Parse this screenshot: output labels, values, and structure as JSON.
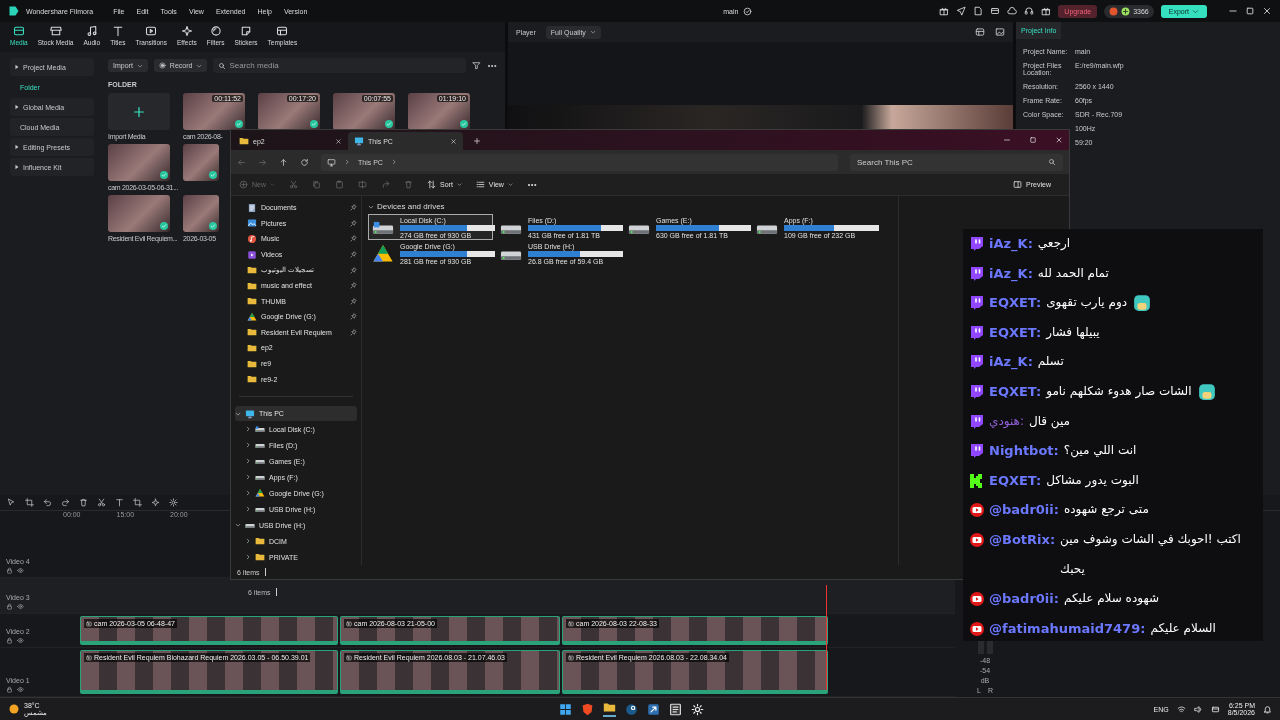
{
  "filmora": {
    "app_title": "Wondershare Filmora",
    "menus": [
      "File",
      "Edit",
      "Tools",
      "View",
      "Extended",
      "Help",
      "Version"
    ],
    "project_name": "main",
    "upgrade": "Upgrade",
    "credits": "3366",
    "export": "Export",
    "tabs": [
      {
        "label": "Media",
        "selected": true
      },
      {
        "label": "Stock Media",
        "selected": false
      },
      {
        "label": "Audio",
        "selected": false
      },
      {
        "label": "Titles",
        "selected": false
      },
      {
        "label": "Transitions",
        "selected": false
      },
      {
        "label": "Effects",
        "selected": false
      },
      {
        "label": "Filters",
        "selected": false
      },
      {
        "label": "Stickers",
        "selected": false
      },
      {
        "label": "Templates",
        "selected": false
      }
    ],
    "sidebar": [
      {
        "label": "Project Media",
        "kind": "group",
        "selected": false
      },
      {
        "label": "Folder",
        "kind": "item",
        "selected": true
      },
      {
        "label": "Global Media",
        "kind": "group",
        "selected": false
      },
      {
        "label": "Cloud Media",
        "kind": "plain",
        "selected": false
      },
      {
        "label": "Editing Presets",
        "kind": "group",
        "selected": false
      },
      {
        "label": "Influence Kit",
        "kind": "group",
        "selected": false
      }
    ],
    "media_bar": {
      "import": "Import",
      "record": "Record",
      "search_placeholder": "Search media"
    },
    "folder_label": "FOLDER",
    "media_rows": [
      [
        {
          "kind": "import",
          "name": "Import Media"
        },
        {
          "kind": "clip",
          "name": "cam 2026-08-",
          "duration": "00:11:52"
        },
        {
          "kind": "clip",
          "duration": "00:17:20"
        },
        {
          "kind": "clip",
          "duration": "00:07:55"
        },
        {
          "kind": "clip",
          "duration": "01:19:10"
        }
      ],
      [
        {
          "kind": "clip",
          "name": "cam 2026-03-05-06-31..."
        },
        {
          "kind": "clip"
        }
      ],
      [
        {
          "kind": "clip",
          "name": "Resident Evil Requiem..."
        },
        {
          "kind": "clip",
          "name": "2026-03-05"
        }
      ]
    ],
    "player": {
      "label": "Player",
      "quality": "Full Quality"
    },
    "project_info": {
      "tab": "Project Info",
      "rows": [
        {
          "label": "Project Name:",
          "value": "main"
        },
        {
          "label": "Project Files Location:",
          "value": "E:/re9/main.wfp"
        },
        {
          "label": "Resolution:",
          "value": "2560 x 1440"
        },
        {
          "label": "Frame Rate:",
          "value": "60fps"
        },
        {
          "label": "Color Space:",
          "value": "SDR - Rec.709"
        },
        {
          "value": "100Hz"
        },
        {
          "value": "59:20"
        }
      ]
    },
    "timeline": {
      "ruler": [
        "00:00",
        "15:00",
        "20:00"
      ],
      "tracks": [
        {
          "label": "Video 4"
        },
        {
          "label": "Video 3"
        },
        {
          "label": "Video 2",
          "clips": [
            "cam 2026-03-05 06-48-47",
            "cam 2026-08-03 21-05-00",
            "cam 2026-08-03 22-08-33"
          ]
        },
        {
          "label": "Video 1",
          "clips": [
            "Resident Evil Requiem Biohazard Requiem 2026.03.05 - 06.50.39.01",
            "Resident Evil Requiem 2026.08.03 - 21.07.46.03",
            "Resident Evil Requiem 2026.08.03 - 22.08.34.04"
          ]
        }
      ],
      "meter": [
        "-48",
        "-54",
        "dB"
      ],
      "channels": [
        "L",
        "R"
      ]
    }
  },
  "explorer": {
    "tabs": [
      {
        "label": "ep2",
        "kind": "folder",
        "selected": false
      },
      {
        "label": "This PC",
        "kind": "pc",
        "selected": true
      }
    ],
    "breadcrumb": [
      "This PC"
    ],
    "search_placeholder": "Search This PC",
    "commands": [
      {
        "label": "New",
        "disabled": true
      },
      {
        "label": "Sort",
        "disabled": false
      },
      {
        "label": "View",
        "disabled": false
      }
    ],
    "preview": "Preview",
    "quick_access": [
      {
        "label": "Documents",
        "kind": "documents",
        "pinned": true
      },
      {
        "label": "Pictures",
        "kind": "pictures",
        "pinned": true
      },
      {
        "label": "Music",
        "kind": "music",
        "pinned": true
      },
      {
        "label": "Videos",
        "kind": "videos",
        "pinned": true
      },
      {
        "label": "تسجيلات اليوتيوب",
        "kind": "folder",
        "pinned": true
      },
      {
        "label": "music and effect",
        "kind": "folder",
        "pinned": true
      },
      {
        "label": "THUMB",
        "kind": "folder",
        "pinned": true
      },
      {
        "label": "Google Drive (G:)",
        "kind": "gdrive",
        "pinned": true
      },
      {
        "label": "Resident Evil Requiem",
        "kind": "folder",
        "pinned": true
      },
      {
        "label": "ep2",
        "kind": "folder",
        "pinned": false
      },
      {
        "label": "re9",
        "kind": "folder",
        "pinned": false
      },
      {
        "label": "re9-2",
        "kind": "folder",
        "pinned": false
      }
    ],
    "tree": [
      {
        "label": "This PC",
        "kind": "pc",
        "expanded": true,
        "selected": true,
        "children": [
          {
            "label": "Local Disk (C:)",
            "kind": "system",
            "expanded": false,
            "selected": false
          },
          {
            "label": "Files (D:)",
            "kind": "drive",
            "expanded": false,
            "selected": false
          },
          {
            "label": "Games (E:)",
            "kind": "drive",
            "expanded": false,
            "selected": false
          },
          {
            "label": "Apps (F:)",
            "kind": "drive",
            "expanded": false,
            "selected": false
          },
          {
            "label": "Google Drive (G:)",
            "kind": "gdrive",
            "expanded": false,
            "selected": false
          },
          {
            "label": "USB Drive (H:)",
            "kind": "drive",
            "expanded": false,
            "selected": false
          }
        ]
      },
      {
        "label": "USB Drive (H:)",
        "kind": "drive",
        "expanded": true,
        "selected": false,
        "children": [
          {
            "label": "DCIM",
            "kind": "folder",
            "expanded": false,
            "selected": false
          },
          {
            "label": "PRIVATE",
            "kind": "folder",
            "expanded": false,
            "selected": false
          }
        ]
      }
    ],
    "section": "Devices and drives",
    "drives": [
      {
        "name": "Local Disk (C:)",
        "kind": "system",
        "free": "274 GB free of 930 GB",
        "level": 0.71,
        "selected": true
      },
      {
        "name": "Files (D:)",
        "kind": "drive",
        "free": "431 GB free of 1.81 TB",
        "level": 0.77,
        "selected": false
      },
      {
        "name": "Games (E:)",
        "kind": "drive",
        "free": "630 GB free of 1.81 TB",
        "level": 0.66,
        "selected": false
      },
      {
        "name": "Apps (F:)",
        "kind": "drive",
        "free": "109 GB free of 232 GB",
        "level": 0.53,
        "selected": false
      },
      {
        "name": "Google Drive (G:)",
        "kind": "gdrive",
        "free": "281 GB free of 930 GB",
        "level": 0.7,
        "selected": false
      },
      {
        "name": "USB Drive (H:)",
        "kind": "drive",
        "free": "26.8 GB free of 59.4 GB",
        "level": 0.55,
        "selected": false
      }
    ],
    "status": "6 items",
    "ghost_status": "6 items"
  },
  "chat": {
    "messages": [
      {
        "kind": "twitch",
        "user": "iAz_K:",
        "text": "ارجعي",
        "color": "#6b78ff",
        "emote": false
      },
      {
        "kind": "twitch",
        "user": "iAz_K:",
        "text": "تمام الحمد لله",
        "color": "#6b78ff",
        "emote": false
      },
      {
        "kind": "twitch",
        "user": "EQXET:",
        "text": "دوم يارب تقهوى",
        "color": "#6b78ff",
        "emote": true
      },
      {
        "kind": "twitch",
        "user": "EQXET:",
        "text": "يبيلها فشار",
        "color": "#6b78ff",
        "emote": false
      },
      {
        "kind": "twitch",
        "user": "iAz_K:",
        "text": "تسلم",
        "color": "#6b78ff",
        "emote": false
      },
      {
        "kind": "twitch",
        "user": "EQXET:",
        "text": "الشات صار هدوء شكلهم نامو",
        "color": "#6b78ff",
        "emote": true
      },
      {
        "kind": "twitch",
        "user": "هنودي:",
        "text": "مين قال",
        "color": "#8e5fd6",
        "emote": false
      },
      {
        "kind": "twitch",
        "user": "Nightbot:",
        "text": "انت اللي مين؟",
        "color": "#6b78ff",
        "emote": false
      },
      {
        "kind": "kick",
        "user": "EQXET:",
        "text": "البوت يدور مشاكل",
        "color": "#6b78ff",
        "emote": false
      },
      {
        "kind": "youtube",
        "user": "@badr0ii:",
        "text": "متى ترجع شهوده",
        "color": "#6b78ff",
        "emote": false
      },
      {
        "kind": "youtube",
        "user": "@BotRix:",
        "text": "اكتب !احوبك في الشات وشوف مين يحبك",
        "color": "#6b78ff",
        "emote": false
      },
      {
        "kind": "youtube",
        "user": "@badr0ii:",
        "text": "شهوده سلام عليكم",
        "color": "#6b78ff",
        "emote": false
      },
      {
        "kind": "youtube",
        "user": "@fatimahumaid7479:",
        "text": "السلام عليكم",
        "color": "#6b78ff",
        "emote": false
      }
    ]
  },
  "taskbar": {
    "weather_temp": "38°C",
    "weather_text": "مشمس",
    "language": "ENG",
    "time": "6:25 PM",
    "date": "8/5/2026"
  }
}
